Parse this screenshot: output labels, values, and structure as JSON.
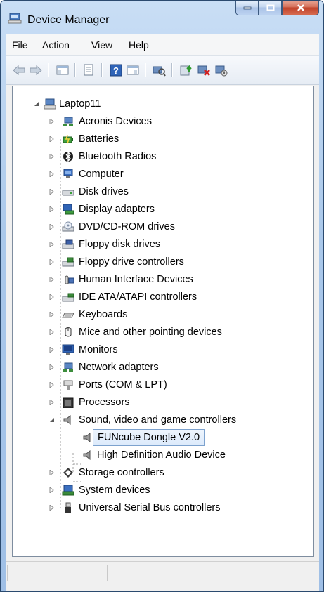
{
  "window": {
    "title": "Device Manager"
  },
  "menu": [
    "File",
    "Action",
    "View",
    "Help"
  ],
  "toolbar": [
    {
      "name": "back-arrow-icon"
    },
    {
      "name": "forward-arrow-icon"
    },
    {
      "name": "show-hide-console-tree-icon"
    },
    {
      "name": "properties-icon"
    },
    {
      "name": "help-icon"
    },
    {
      "name": "show-action-pane-icon"
    },
    {
      "name": "scan-hardware-icon"
    },
    {
      "name": "update-driver-icon"
    },
    {
      "name": "uninstall-icon"
    },
    {
      "name": "disable-icon"
    }
  ],
  "tree": {
    "root": "Laptop11",
    "categories": [
      {
        "label": "Acronis Devices",
        "icon": "network-adapter-icon"
      },
      {
        "label": "Batteries",
        "icon": "battery-icon"
      },
      {
        "label": "Bluetooth Radios",
        "icon": "bluetooth-icon"
      },
      {
        "label": "Computer",
        "icon": "computer-icon"
      },
      {
        "label": "Disk drives",
        "icon": "disk-drive-icon"
      },
      {
        "label": "Display adapters",
        "icon": "display-adapter-icon"
      },
      {
        "label": "DVD/CD-ROM drives",
        "icon": "dvd-drive-icon"
      },
      {
        "label": "Floppy disk drives",
        "icon": "floppy-drive-icon"
      },
      {
        "label": "Floppy drive controllers",
        "icon": "floppy-controller-icon"
      },
      {
        "label": "Human Interface Devices",
        "icon": "hid-icon"
      },
      {
        "label": "IDE ATA/ATAPI controllers",
        "icon": "ide-controller-icon"
      },
      {
        "label": "Keyboards",
        "icon": "keyboard-icon"
      },
      {
        "label": "Mice and other pointing devices",
        "icon": "mouse-icon"
      },
      {
        "label": "Monitors",
        "icon": "monitor-icon"
      },
      {
        "label": "Network adapters",
        "icon": "network-adapter-icon"
      },
      {
        "label": "Ports (COM & LPT)",
        "icon": "port-icon"
      },
      {
        "label": "Processors",
        "icon": "processor-icon"
      },
      {
        "label": "Sound, video and game controllers",
        "icon": "speaker-icon",
        "expanded": true,
        "children": [
          {
            "label": "FUNcube Dongle V2.0",
            "selected": true
          },
          {
            "label": "High Definition Audio Device"
          }
        ]
      },
      {
        "label": "Storage controllers",
        "icon": "storage-controller-icon"
      },
      {
        "label": "System devices",
        "icon": "system-device-icon"
      },
      {
        "label": "Universal Serial Bus controllers",
        "icon": "usb-icon"
      }
    ]
  }
}
